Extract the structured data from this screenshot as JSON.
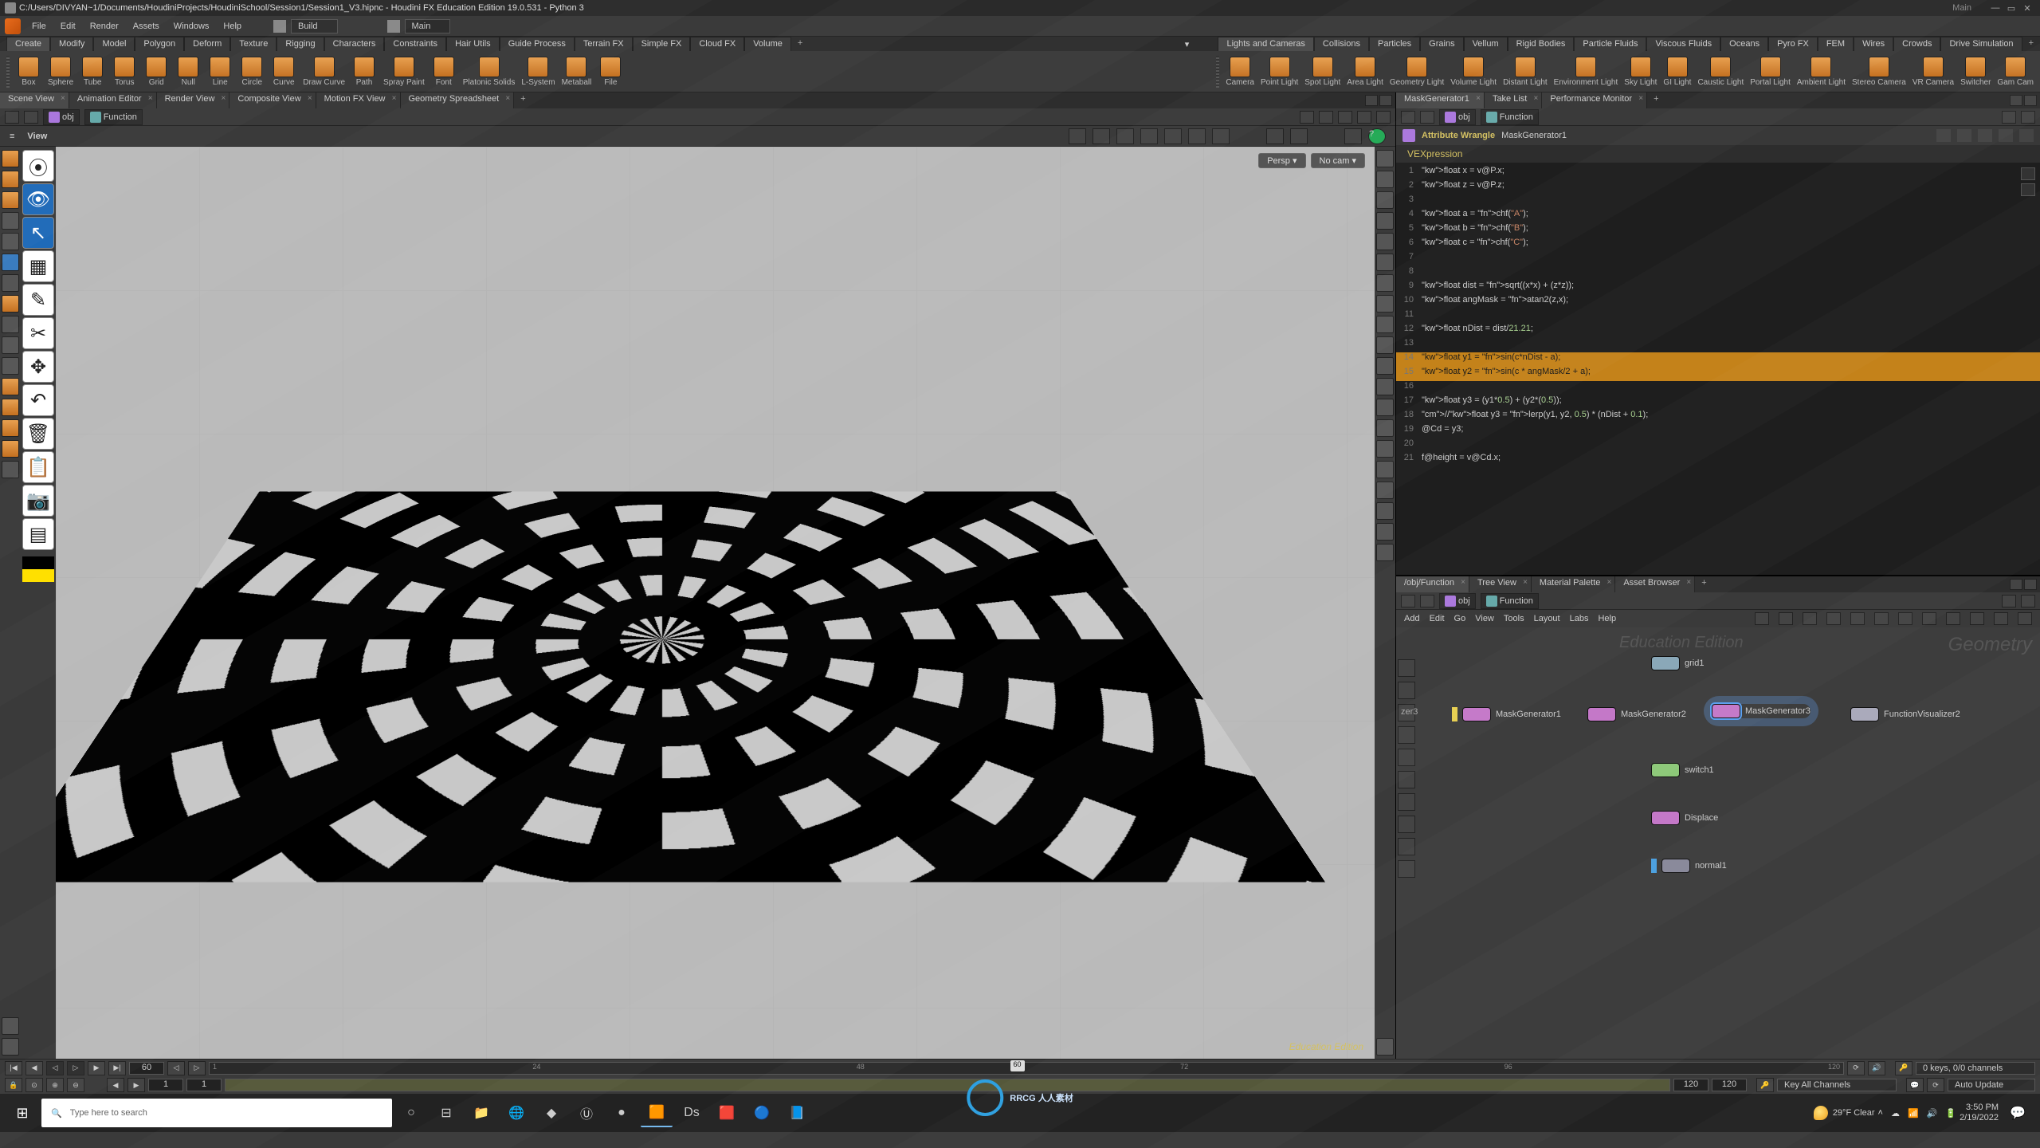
{
  "titlebar": {
    "path": "C:/Users/DIVYAN~1/Documents/HoudiniProjects/HoudiniSchool/Session1/Session1_V3.hipnc - Houdini FX Education Edition 19.0.531 - Python 3"
  },
  "menu": [
    "File",
    "Edit",
    "Render",
    "Assets",
    "Windows",
    "Help"
  ],
  "desktops": {
    "current": "Build",
    "assign": "Main"
  },
  "shelf": {
    "tabsLeft": [
      "Create",
      "Modify",
      "Model",
      "Polygon",
      "Deform",
      "Texture",
      "Rigging",
      "Characters",
      "Constraints",
      "Hair Utils",
      "Guide Process",
      "Terrain FX",
      "Simple FX",
      "Cloud FX",
      "Volume"
    ],
    "tabsRight": [
      "Lights and Cameras",
      "Collisions",
      "Particles",
      "Grains",
      "Vellum",
      "Rigid Bodies",
      "Particle Fluids",
      "Viscous Fluids",
      "Oceans",
      "Pyro FX",
      "FEM",
      "Wires",
      "Crowds",
      "Drive Simulation"
    ],
    "toolsLeft": [
      "Box",
      "Sphere",
      "Tube",
      "Torus",
      "Grid",
      "Null",
      "Line",
      "Circle",
      "Curve",
      "Draw Curve",
      "Path",
      "Spray Paint",
      "Font",
      "Platonic Solids",
      "L-System",
      "Metaball",
      "File"
    ],
    "toolsRight": [
      "Camera",
      "Point Light",
      "Spot Light",
      "Area Light",
      "Geometry Light",
      "Volume Light",
      "Distant Light",
      "Environment Light",
      "Sky Light",
      "GI Light",
      "Caustic Light",
      "Portal Light",
      "Ambient Light",
      "Stereo Camera",
      "VR Camera",
      "Switcher",
      "Gam Cam"
    ]
  },
  "leftPaneTabs": [
    "Scene View",
    "Animation Editor",
    "Render View",
    "Composite View",
    "Motion FX View",
    "Geometry Spreadsheet"
  ],
  "rightPaneTabs": [
    "MaskGenerator1",
    "Take List",
    "Performance Monitor"
  ],
  "bottomPaneTabs": [
    "/obj/Function",
    "Tree View",
    "Material Palette",
    "Asset Browser"
  ],
  "path": {
    "level1": "obj",
    "level2": "Function"
  },
  "viewer": {
    "label": "View",
    "persp": "Persp",
    "cam": "No cam",
    "edition": "Education Edition"
  },
  "params": {
    "nodetype": "Attribute Wrangle",
    "nodename": "MaskGenerator1",
    "section": "VEXpression"
  },
  "code_plain": [
    "float x = v@P.x;",
    "float z = v@P.z;",
    "",
    "float a = chf(\"A\");",
    "float b = chf(\"B\");",
    "float c = chf(\"C\");",
    "",
    "",
    "float dist = sqrt((x*x) + (z*z));",
    "float angMask = atan2(z,x);",
    "",
    "float nDist = dist/21.21;",
    "",
    "float y1 = sin(c*nDist - a);",
    "float y2 = sin(c * angMask/2 + a);",
    "",
    "float y3 = (y1*0.5) + (y2*(0.5));",
    "//float y3 = lerp(y1, y2, 0.5) * (nDist + 0.1);",
    "@Cd = y3;",
    "",
    "f@height = v@Cd.x;"
  ],
  "code_hl": [
    14,
    15
  ],
  "networkMenu": [
    "Add",
    "Edit",
    "Go",
    "View",
    "Tools",
    "Layout",
    "Labs",
    "Help"
  ],
  "networkLabels": {
    "edition": "Education Edition",
    "context": "Geometry"
  },
  "nodes": {
    "grid1": "grid1",
    "mg1": "MaskGenerator1",
    "mg2": "MaskGenerator2",
    "mg3": "MaskGenerator3",
    "fv2": "FunctionVisualizer2",
    "switch1": "switch1",
    "displace": "Displace",
    "normal1": "normal1",
    "sidecut": "zer3"
  },
  "timeline": {
    "current": "60",
    "marker": "60",
    "start": "1",
    "rstart": "1",
    "rend": "120",
    "end": "120",
    "ticks": [
      "1",
      "24",
      "48",
      "72",
      "96",
      "120"
    ],
    "keys": "0 keys, 0/0 channels",
    "scope": "Key All Channels",
    "update": "Auto Update"
  },
  "taskbar": {
    "searchPlaceholder": "Type here to search",
    "weather": "29°F  Clear",
    "time": "3:50 PM",
    "date": "2/19/2022"
  },
  "watermark": "RRCG 人人素材"
}
